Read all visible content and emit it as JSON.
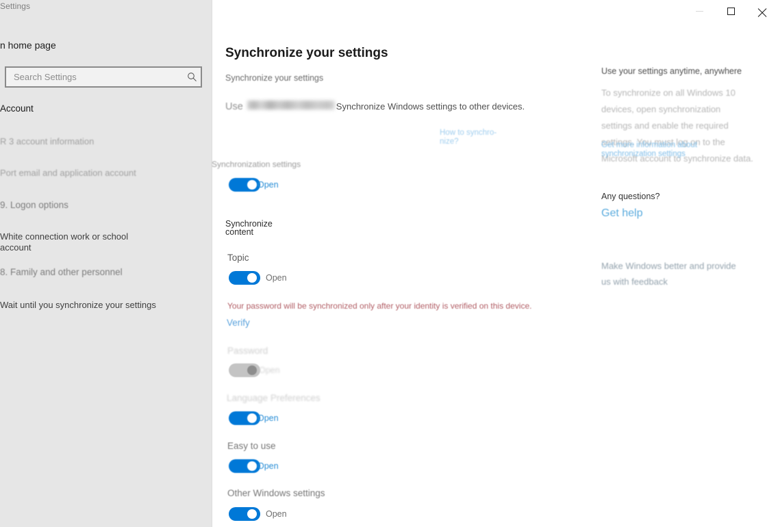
{
  "window": {
    "app_title": "Settings",
    "controls": {
      "minimize": "minimize-icon",
      "maximize": "maximize-icon",
      "close": "close-icon"
    }
  },
  "sidebar": {
    "home_link": "n home page",
    "search": {
      "placeholder": "Search Settings",
      "value": "",
      "icon": "search-icon"
    },
    "section_title": "Account",
    "items": [
      {
        "label": "R 3 account information",
        "style": "dim"
      },
      {
        "label": "Port email and application account",
        "style": "dim"
      },
      {
        "label": "9. Logon options",
        "style": "normal"
      },
      {
        "label": "White connection work or school account",
        "style": "strong"
      },
      {
        "label": "8. Family and other personnel",
        "style": "normal"
      },
      {
        "label": "Wait until you synchronize your settings",
        "style": "strong"
      }
    ]
  },
  "main": {
    "page_title": "Synchronize your settings",
    "sub_head": "Synchronize your settings",
    "use_row": {
      "prefix": "Use",
      "account_redacted": true,
      "suffix": "Synchronize Windows settings to other devices."
    },
    "how_to_link": "How to synchro-nize?",
    "sync_settings_label": "Synchronization settings",
    "master_toggle": {
      "label": "Open",
      "state": "on"
    },
    "sync_content_label": "Synchronize content",
    "settings": [
      {
        "name": "Topic",
        "toggle_label": "Open",
        "state": "on",
        "disabled": false
      },
      {
        "name": "Password",
        "toggle_label": "Open",
        "state": "off",
        "disabled": true
      },
      {
        "name": "Language Preferences",
        "toggle_label": "Open",
        "state": "on",
        "disabled": false
      },
      {
        "name": "Easy to use",
        "toggle_label": "Open",
        "state": "on",
        "disabled": false
      },
      {
        "name": "Other Windows settings",
        "toggle_label": "Open",
        "state": "on",
        "disabled": false
      }
    ],
    "password_warning": "Your password will be synchronized only after your identity is verified on this device.",
    "verify_link": "Verify"
  },
  "right_pane": {
    "heading": "Use your settings anytime, anywhere",
    "body": "To synchronize on all Windows 10 devices, open synchronization settings and enable the required settings. You must log on to the Microsoft account to synchronize data.",
    "more_info_link": "Get more information about synchronization settings",
    "questions_heading": "Any questions?",
    "get_help_link": "Get help",
    "feedback_link": "Make Windows better and provide us with feedback"
  },
  "colors": {
    "accent": "#0078d7",
    "link": "#4a9fe0",
    "warning": "#b25f66",
    "sidebar_bg": "#e6e6e6",
    "content_bg": "#ffffff",
    "toggle_off": "#c4c4c4"
  }
}
